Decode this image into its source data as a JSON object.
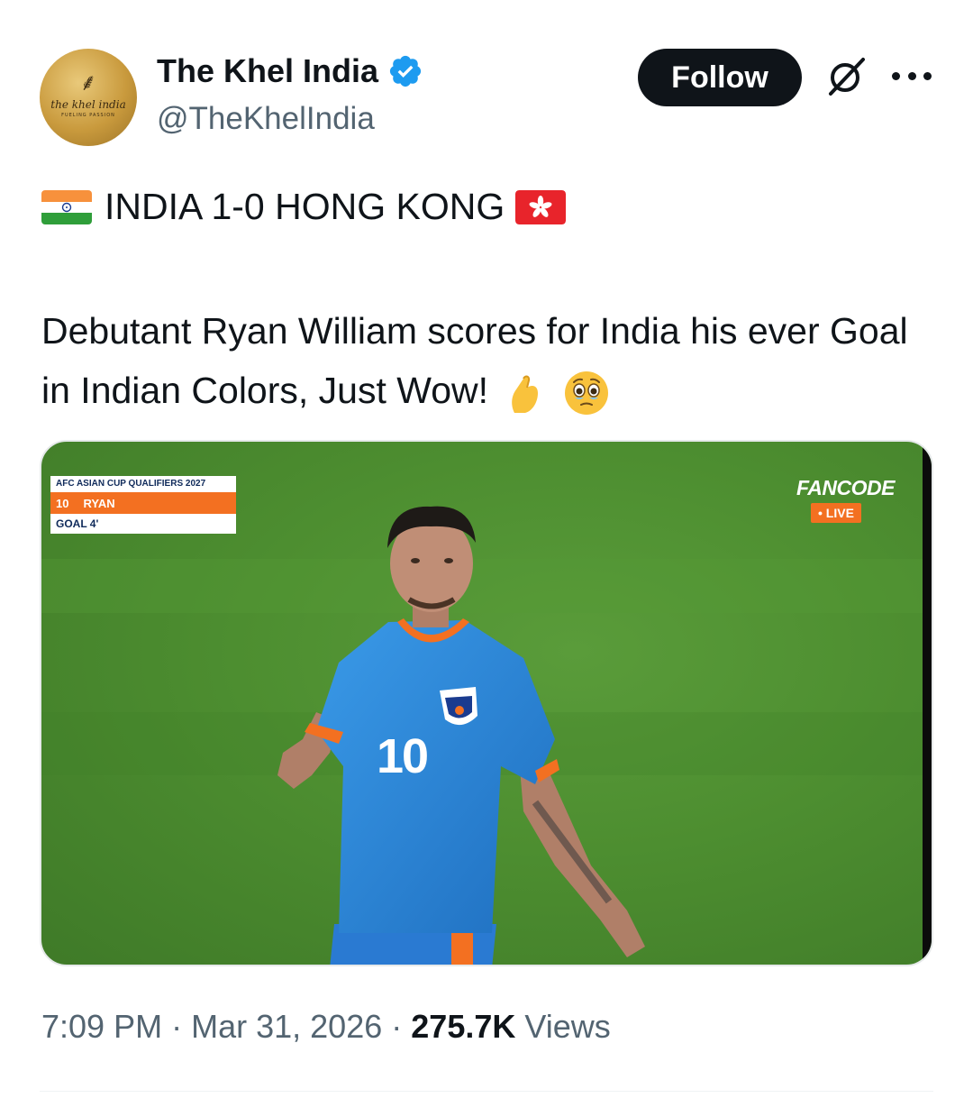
{
  "author": {
    "display_name": "The Khel India",
    "handle": "@TheKhelIndia",
    "verified": true,
    "avatar_brand": "the khel india",
    "avatar_tagline": "FUELING PASSION"
  },
  "actions": {
    "follow_label": "Follow"
  },
  "tweet": {
    "headline": "INDIA 1-0 HONG KONG",
    "body": "Debutant Ryan William scores for India his ever Goal in Indian Colors, Just Wow!",
    "flags": [
      "india-flag-icon",
      "hong-kong-flag-icon"
    ],
    "emojis": [
      "pinched-fingers-icon",
      "face-holding-back-tears-icon"
    ]
  },
  "media": {
    "scorebug": {
      "competition": "AFC ASIAN CUP QUALIFIERS 2027",
      "number": "10",
      "player": "RYAN",
      "event": "GOAL 4'"
    },
    "broadcaster": "FANCODE",
    "live_label": "• LIVE",
    "jersey_number": "10"
  },
  "meta": {
    "time": "7:09 PM",
    "separator": "·",
    "date": "Mar 31, 2026",
    "views_count": "275.7K",
    "views_label": "Views"
  },
  "colors": {
    "text_primary": "#0f1419",
    "text_secondary": "#536471",
    "verified_blue": "#1d9bf0",
    "scorebug_orange": "#f37021",
    "jersey_blue": "#2f8fe0",
    "pitch_green": "#4d8e30"
  }
}
